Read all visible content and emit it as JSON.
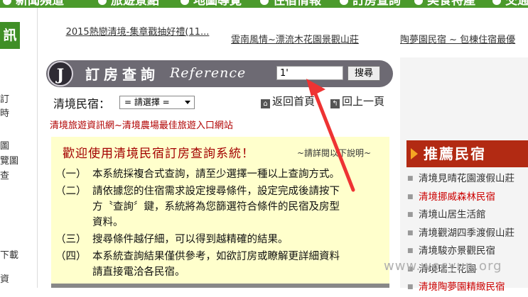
{
  "top_nav": [
    "新聞頻道",
    "旅遊景點",
    "地圖導覽",
    "住宿情報",
    "訂房查詢",
    "美食特產",
    "交通"
  ],
  "left_sidebar": {
    "heading": "訊",
    "fragments": [
      "訂",
      "時",
      "圖",
      "覽圖",
      "查",
      "下載",
      "資"
    ]
  },
  "top_links": [
    "2015熱戀清境-集章戳抽好禮(11...",
    "雲南風情~漂流木花園景觀山莊",
    "陶夢園民宿 ~ 包棟住宿最優"
  ],
  "reference_bar": {
    "logo_letter": "J",
    "title": "訂房查詢",
    "subtitle": "Reference",
    "search_value": "1'",
    "search_button": "搜尋"
  },
  "region": {
    "label": "清境民宿：",
    "selected": "= 請選擇 ="
  },
  "nav_links": {
    "home": "返回首頁",
    "back": "回上一頁"
  },
  "portal_link": "清境旅遊資訊網~清境農場最佳旅遊入口網站",
  "info_box": {
    "welcome": "歡迎使用清境民宿訂房查詢系統！",
    "detail_hint": "~請詳閱以下說明~",
    "items": [
      {
        "num": "（一）",
        "lines": [
          "本系統採複合式查詢，請至少選擇一種以上查詢方式。"
        ]
      },
      {
        "num": "（二）",
        "lines": [
          "請依據您的住宿需求設定搜尋條件，設定完成後請按下",
          "方〝查詢〞鍵，系統將為您篩選符合條件的民宿及房型",
          "資料。"
        ]
      },
      {
        "num": "（三）",
        "lines": [
          "搜尋條件越仔細，可以得到越精確的結果。"
        ]
      },
      {
        "num": "（四）",
        "lines": [
          "本系統查詢結果僅供參考，如欲訂房或瞭解更詳細資料",
          "請直接電洽各民宿。"
        ]
      }
    ]
  },
  "recommend": {
    "heading": "推薦民宿",
    "items": [
      {
        "name": "清境見晴花園渡假山莊"
      },
      {
        "name": "清境挪威森林民宿"
      },
      {
        "name": "清境山居生活館"
      },
      {
        "name": "清境觀湖四季渡假山莊"
      },
      {
        "name": "清境駿亦景觀民宿"
      },
      {
        "name": "清境瑞士花園"
      },
      {
        "name": "清境陶夢園精緻民宿"
      }
    ]
  },
  "watermark": "www.wocyun.org",
  "colors": {
    "nav_green": "#4b9a2c",
    "ref_bar": "#6d6a73",
    "info_bg": "#ffffcc",
    "recommend_red": "#b22a13",
    "link_red": "#b00000",
    "arrow_red": "#ee3333"
  }
}
